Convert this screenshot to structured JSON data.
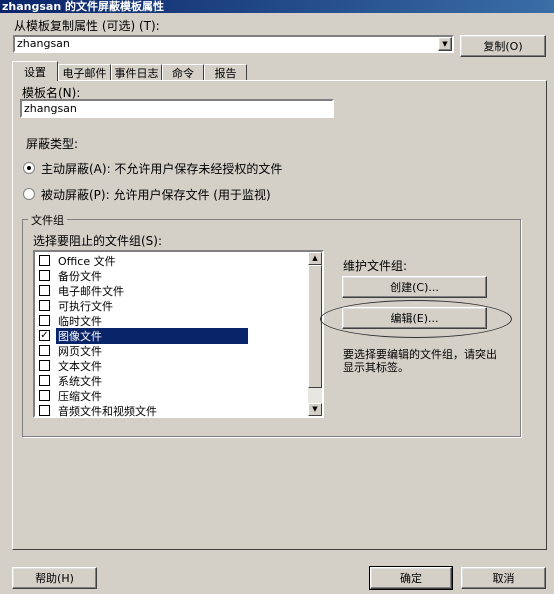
{
  "window": {
    "title": "zhangsan 的文件屏蔽模板属性"
  },
  "copy_from": {
    "label": "从模板复制属性 (可选) (T):",
    "value": "zhangsan",
    "copy_button": "复制(O)"
  },
  "tabs": [
    {
      "label": "设置",
      "active": true
    },
    {
      "label": "电子邮件"
    },
    {
      "label": "事件日志"
    },
    {
      "label": "命令"
    },
    {
      "label": "报告"
    }
  ],
  "template_name": {
    "label": "模板名(N):",
    "value": "zhangsan"
  },
  "screening_type": {
    "heading": "屏蔽类型:",
    "active_label": "主动屏蔽(A): 不允许用户保存未经授权的文件",
    "passive_label": "被动屏蔽(P): 允许用户保存文件 (用于监视)",
    "selected": "active"
  },
  "file_groups": {
    "group_title": "文件组",
    "list_label": "选择要阻止的文件组(S):",
    "items": [
      {
        "label": "Office 文件",
        "checked": false
      },
      {
        "label": "备份文件",
        "checked": false
      },
      {
        "label": "电子邮件文件",
        "checked": false
      },
      {
        "label": "可执行文件",
        "checked": false
      },
      {
        "label": "临时文件",
        "checked": false
      },
      {
        "label": "图像文件",
        "checked": true,
        "selected": true
      },
      {
        "label": "网页文件",
        "checked": false
      },
      {
        "label": "文本文件",
        "checked": false
      },
      {
        "label": "系统文件",
        "checked": false
      },
      {
        "label": "压缩文件",
        "checked": false
      },
      {
        "label": "音频文件和视频文件",
        "checked": false
      }
    ],
    "maintain_label": "维护文件组:",
    "create_button": "创建(C)...",
    "edit_button": "编辑(E)...",
    "hint": "要选择要编辑的文件组，请突出显示其标签。"
  },
  "buttons": {
    "help": "帮助(H)",
    "ok": "确定",
    "cancel": "取消"
  },
  "check_mark": "✓",
  "colors": {
    "face": "#d4d0c8",
    "title": "#0a246a",
    "selection": "#0a246a"
  }
}
